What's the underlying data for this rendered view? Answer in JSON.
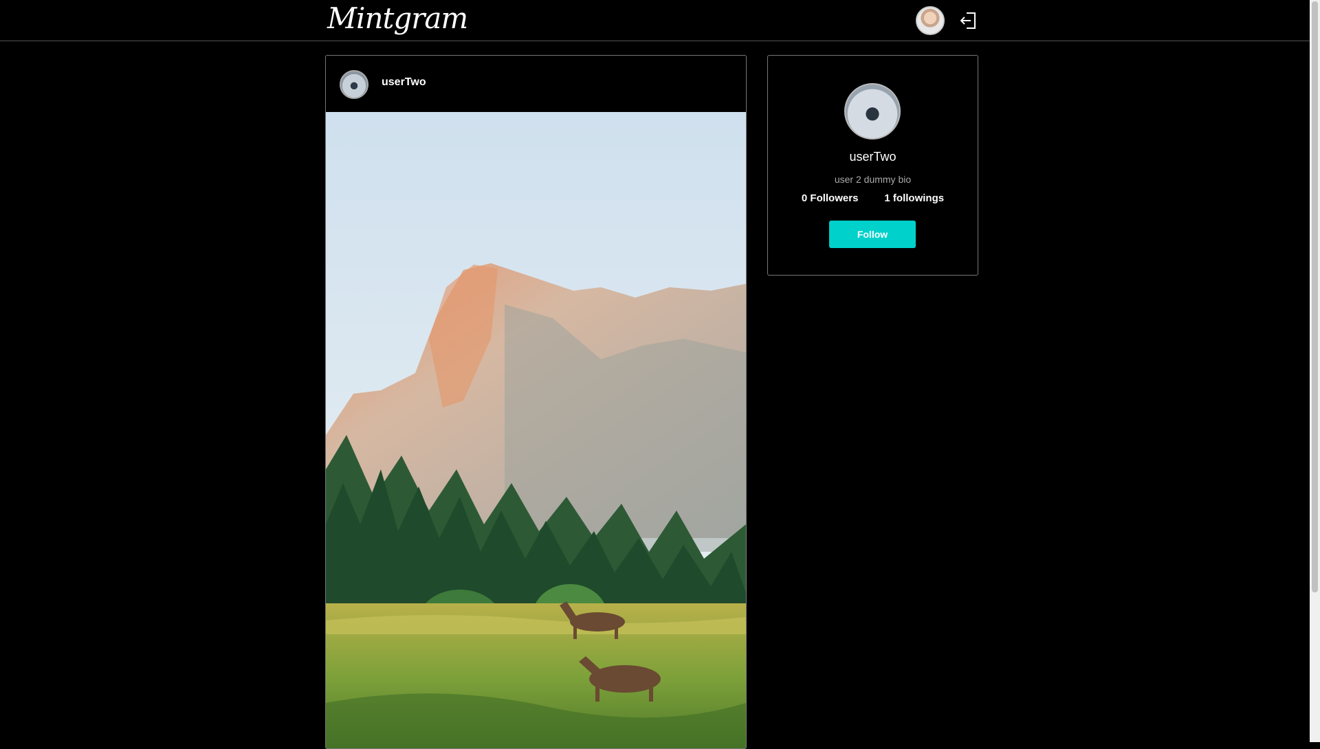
{
  "header": {
    "logo": "Mintgram",
    "avatar_icon": "user-avatar",
    "logout_icon": "logout-icon"
  },
  "post": {
    "username": "userTwo",
    "image_subject": "mountain-landscape-with-deer"
  },
  "profile": {
    "name": "userTwo",
    "bio": "user 2 dummy bio",
    "followers": "0 Followers",
    "followings": "1 followings",
    "follow_label": "Follow"
  },
  "colors": {
    "background": "#000000",
    "accent": "#00d1cb",
    "border": "#777777"
  }
}
